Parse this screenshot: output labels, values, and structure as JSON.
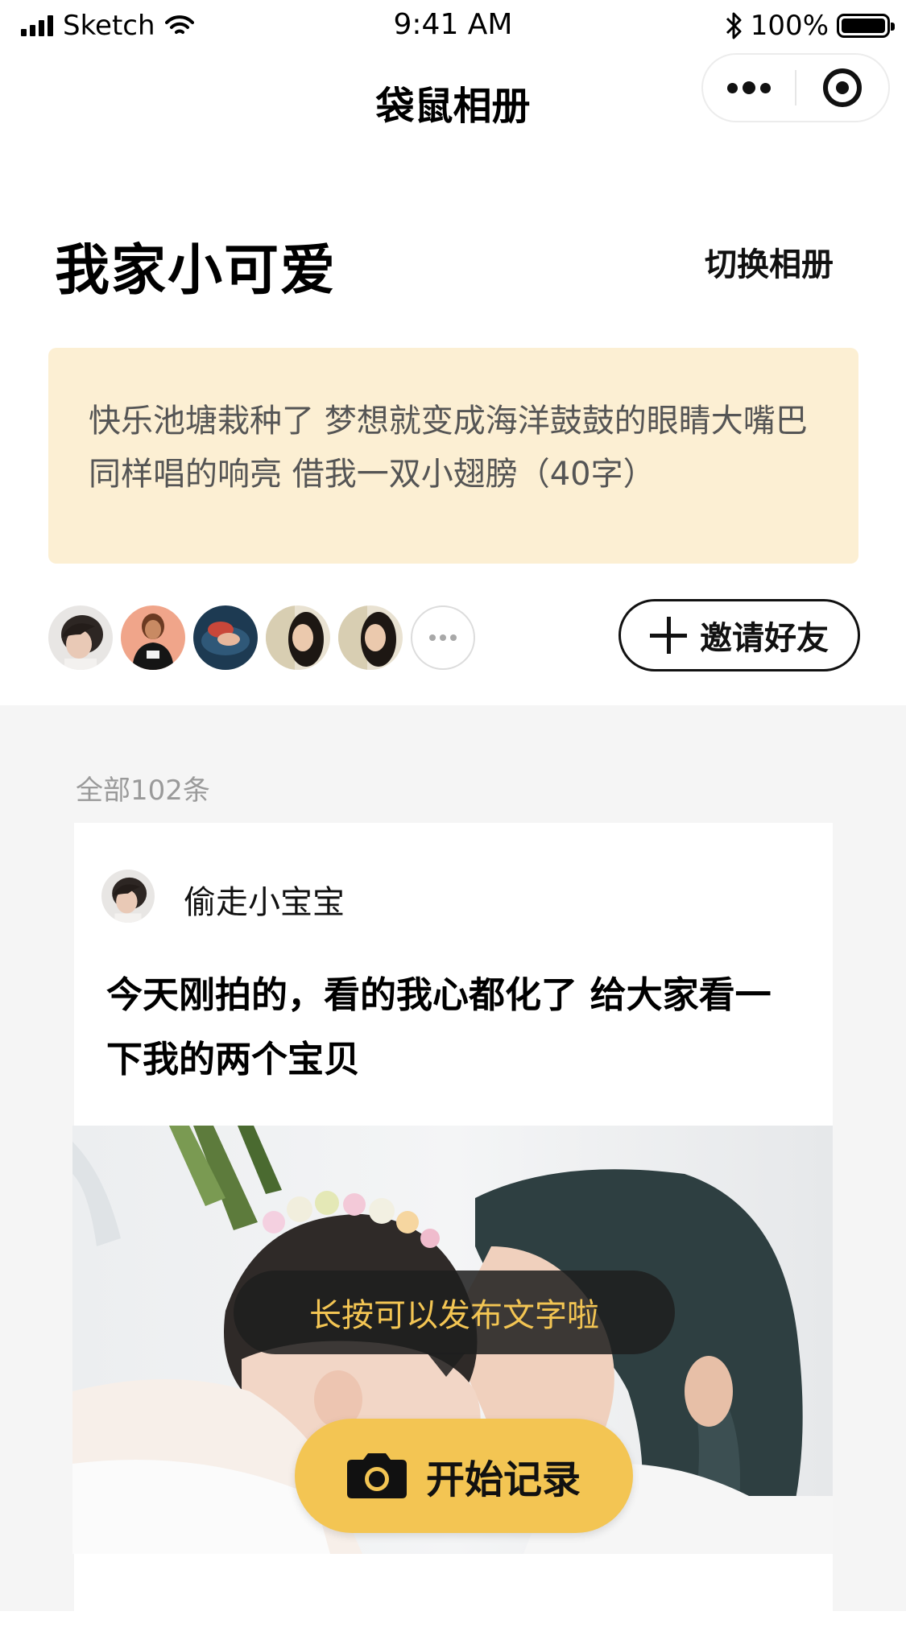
{
  "status_bar": {
    "carrier": "Sketch",
    "time": "9:41 AM",
    "battery": "100%"
  },
  "nav": {
    "title": "袋鼠相册"
  },
  "album": {
    "name": "我家小可爱",
    "switch_label": "切换相册",
    "description": "快乐池塘栽种了 梦想就变成海洋鼓鼓的眼睛大嘴巴 同样唱的响亮 借我一双小翅膀（40字）"
  },
  "members": {
    "invite_label": "邀请好友"
  },
  "feed": {
    "total_count": "全部102条",
    "post": {
      "author": "偷走小宝宝",
      "text": "今天刚拍的，看的我心都化了 给大家看一下我的两个宝贝"
    }
  },
  "tooltip": {
    "text": "长按可以发布文字啦"
  },
  "record_button": {
    "label": "开始记录"
  },
  "colors": {
    "accent_yellow": "#f3c553",
    "description_bg": "#fcefd3",
    "feed_bg": "#f5f5f5"
  }
}
